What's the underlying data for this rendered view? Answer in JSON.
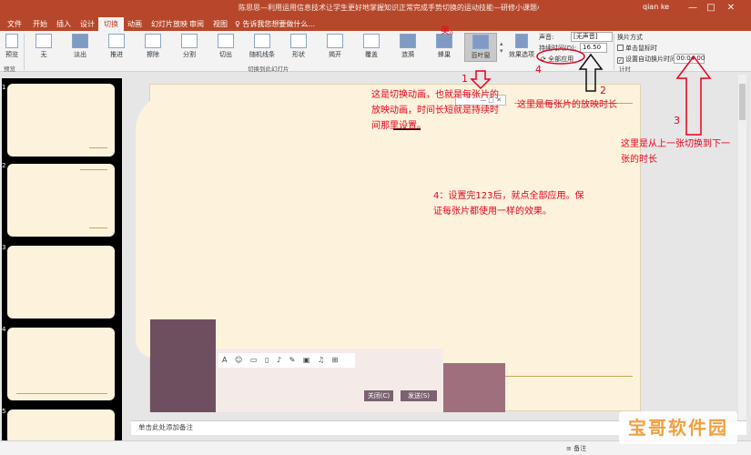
{
  "window": {
    "title": "陈思思—利用运用信息技术让学生更好地掌握知识正常完成手势切换的运动技能—研修小课题小组.pptx [兼容模式] - PowerPoint",
    "user": "qian ke",
    "min": "—",
    "max": "□",
    "close": "✕"
  },
  "tabs": [
    {
      "label": "文件"
    },
    {
      "label": "开始"
    },
    {
      "label": "插入"
    },
    {
      "label": "设计"
    },
    {
      "label": "切换"
    },
    {
      "label": "动画"
    },
    {
      "label": "幻灯片放映"
    },
    {
      "label": "审阅"
    },
    {
      "label": "视图"
    }
  ],
  "tell_me": "♀ 告诉我您想要做什么...",
  "ribbon": {
    "preview_label": "预览",
    "preview_group": "预览",
    "transitions": [
      {
        "label": "无"
      },
      {
        "label": "淡出"
      },
      {
        "label": "推进"
      },
      {
        "label": "擦除"
      },
      {
        "label": "分割"
      },
      {
        "label": "切出"
      },
      {
        "label": "随机线条"
      },
      {
        "label": "形状"
      },
      {
        "label": "揭开"
      },
      {
        "label": "覆盖"
      },
      {
        "label": "涟漪"
      },
      {
        "label": "蜂巢"
      },
      {
        "label": "百叶窗"
      }
    ],
    "group_label": "切换到此幻灯片",
    "effect_options": "效果选项",
    "sound_label": "声音:",
    "sound_value": "[无声音]",
    "duration_label": "持续时间(D):",
    "duration_value": "16.50",
    "apply_all": "全部应用",
    "advance_title": "换片方式",
    "on_click": "单击鼠标时",
    "after_label": "设置自动换片时间:",
    "after_value": "00:04.00",
    "timing_group": "计时"
  },
  "slides": {
    "numbers": [
      "1",
      "2",
      "3",
      "4",
      "5"
    ]
  },
  "editor": {
    "toolbar_icons": "A ☺ ▭ ▯ ♪ ✎ ▣ ♫ ⊞",
    "close_btn": "关闭(C)",
    "send_btn": "发送(S)"
  },
  "notes_placeholder": "单击此处添加备注",
  "status": {
    "notes_btn": "备注",
    "watermark": "宝哥软件园"
  },
  "annotations": {
    "n1": "1",
    "n2": "2",
    "n3": "3",
    "n4": "4",
    "top_text": "美。",
    "text1": "这是切换动画，也就是每张片的放映动画，时间长短就是持续时间那里设置。",
    "text2": "这里是每张片的放映时长",
    "text3": "这里是从上一张切换到下一张的时长",
    "text4": "4：设置完123后，就点全部应用。保证每张片都使用一样的效果。"
  },
  "colors": {
    "accent": "#b7472a",
    "annotation": "#e8001d",
    "slide_bg": "#fdf3dc"
  }
}
